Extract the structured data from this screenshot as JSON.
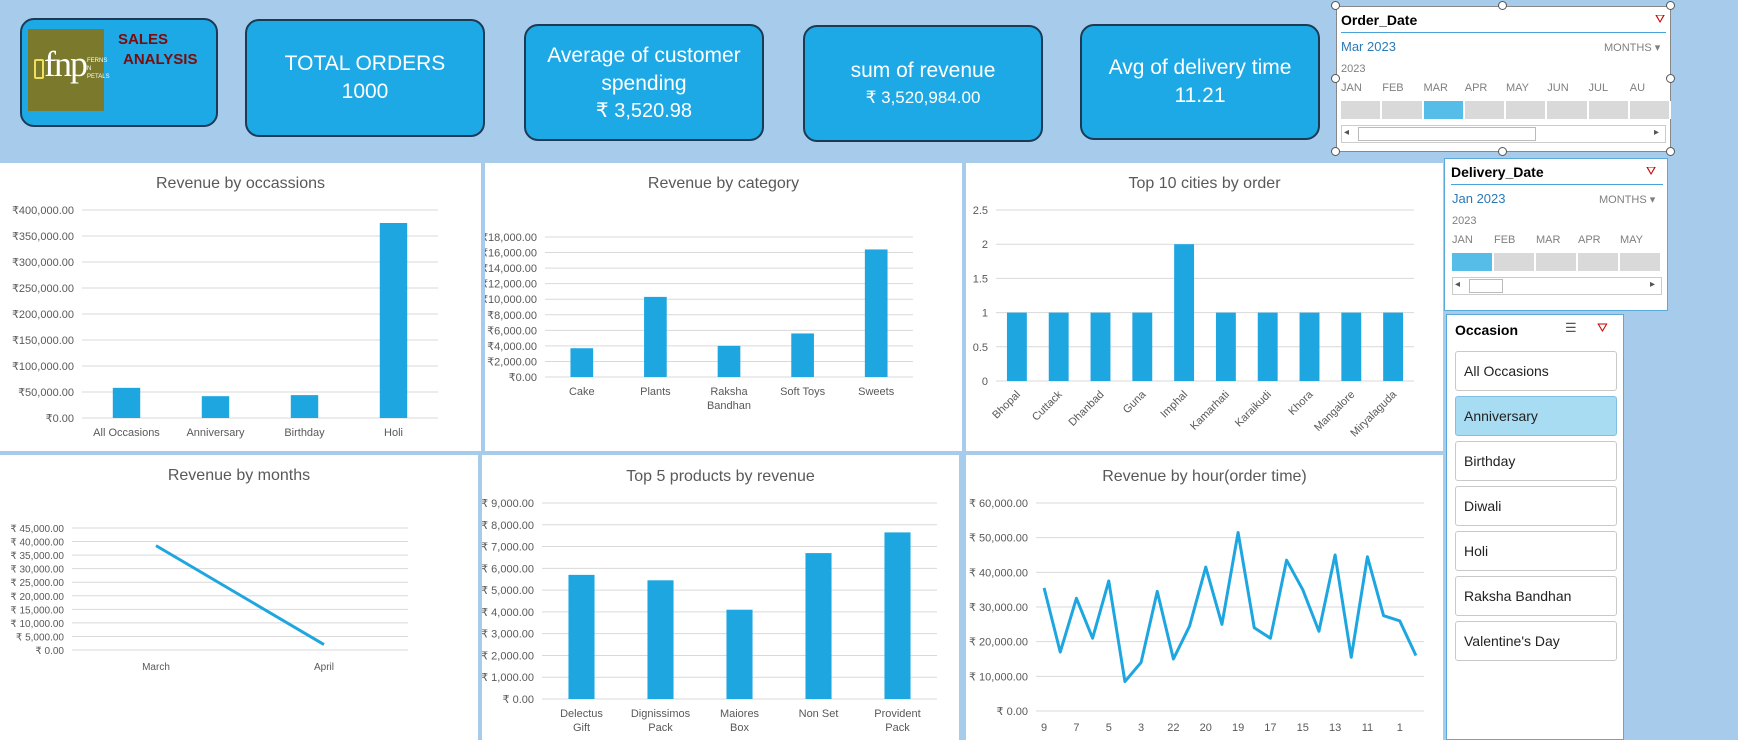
{
  "header": {
    "logo_text": "fnp",
    "logo_sub": "FERNS N PETALS",
    "title_line1": "SALES",
    "title_line2": "ANALYSIS"
  },
  "kpis": {
    "orders": {
      "title": "TOTAL ORDERS",
      "value": "1000"
    },
    "avg_spend": {
      "title1": "Average of customer",
      "title2": "spending",
      "value": "₹ 3,520.98"
    },
    "revenue": {
      "title": "sum of revenue",
      "value": "₹ 3,520,984.00"
    },
    "delivery": {
      "title": "Avg of delivery time",
      "value": "11.21"
    }
  },
  "slicers": {
    "order_date": {
      "title": "Order_Date",
      "selection": "Mar 2023",
      "mode": "MONTHS",
      "year": "2023",
      "months": [
        "JAN",
        "FEB",
        "MAR",
        "APR",
        "MAY",
        "JUN",
        "JUL",
        "AU"
      ],
      "selected_index": 2
    },
    "delivery_date": {
      "title": "Delivery_Date",
      "selection": "Jan 2023",
      "mode": "MONTHS",
      "year": "2023",
      "months": [
        "JAN",
        "FEB",
        "MAR",
        "APR",
        "MAY"
      ],
      "selected_index": 0
    },
    "occasion": {
      "title": "Occasion",
      "items": [
        "All Occasions",
        "Anniversary",
        "Birthday",
        "Diwali",
        "Holi",
        "Raksha Bandhan",
        "Valentine's Day"
      ],
      "selected": "Anniversary"
    }
  },
  "chart_data": [
    {
      "id": "occasions",
      "type": "bar",
      "title": "Revenue by occassions",
      "categories": [
        "All Occasions",
        "Anniversary",
        "Birthday",
        "Holi"
      ],
      "values": [
        58000,
        42000,
        44000,
        375000
      ],
      "ylim": [
        0,
        400000
      ],
      "ticks": [
        "₹0.00",
        "₹50,000.00",
        "₹100,000.00",
        "₹150,000.00",
        "₹200,000.00",
        "₹250,000.00",
        "₹300,000.00",
        "₹350,000.00",
        "₹400,000.00"
      ]
    },
    {
      "id": "category",
      "type": "bar",
      "title": "Revenue by category",
      "categories": [
        "Cake",
        "Plants",
        "Raksha Bandhan",
        "Soft Toys",
        "Sweets"
      ],
      "values": [
        3700,
        10300,
        4000,
        5600,
        16400
      ],
      "ylim": [
        0,
        18000
      ],
      "ticks": [
        "₹0.00",
        "₹2,000.00",
        "₹4,000.00",
        "₹6,000.00",
        "₹8,000.00",
        "₹10,000.00",
        "₹12,000.00",
        "₹14,000.00",
        "₹16,000.00",
        "₹18,000.00"
      ]
    },
    {
      "id": "cities",
      "type": "bar",
      "title": "Top 10 cities by order",
      "categories": [
        "Bhopal",
        "Cuttack",
        "Dhanbad",
        "Guna",
        "Imphal",
        "Kamarhati",
        "Karaikudi",
        "Khora",
        "Mangalore",
        "Miryalaguda"
      ],
      "values": [
        1,
        1,
        1,
        1,
        2,
        1,
        1,
        1,
        1,
        1
      ],
      "ylim": [
        0,
        2.5
      ],
      "ticks": [
        "0",
        "0.5",
        "1",
        "1.5",
        "2",
        "2.5"
      ]
    },
    {
      "id": "months",
      "type": "line",
      "title": "Revenue by months",
      "categories": [
        "March",
        "April"
      ],
      "values": [
        38500,
        2000
      ],
      "ylim": [
        0,
        45000
      ],
      "ticks": [
        "₹ 0.00",
        "₹ 5,000.00",
        "₹ 10,000.00",
        "₹ 15,000.00",
        "₹ 20,000.00",
        "₹ 25,000.00",
        "₹ 30,000.00",
        "₹ 35,000.00",
        "₹ 40,000.00",
        "₹ 45,000.00"
      ]
    },
    {
      "id": "products",
      "type": "bar",
      "title": "Top 5 products by revenue",
      "categories": [
        "Delectus Gift",
        "Dignissimos Pack",
        "Maiores Box",
        "Non Set",
        "Provident Pack"
      ],
      "values": [
        5700,
        5450,
        4100,
        6700,
        7650
      ],
      "ylim": [
        0,
        9000
      ],
      "ticks": [
        "₹ 0.00",
        "₹ 1,000.00",
        "₹ 2,000.00",
        "₹ 3,000.00",
        "₹ 4,000.00",
        "₹ 5,000.00",
        "₹ 6,000.00",
        "₹ 7,000.00",
        "₹ 8,000.00",
        "₹ 9,000.00"
      ]
    },
    {
      "id": "hours",
      "type": "line",
      "title": "Revenue by hour(order time)",
      "categories": [
        "9",
        "",
        "7",
        "",
        "5",
        "",
        "3",
        "",
        "22",
        "",
        "20",
        "",
        "19",
        "",
        "17",
        "",
        "15",
        "",
        "13",
        "",
        "11",
        "",
        "1",
        ""
      ],
      "values": [
        35500,
        17000,
        32500,
        21000,
        37500,
        8500,
        14000,
        34500,
        15000,
        24500,
        41500,
        25000,
        51500,
        24000,
        21000,
        43500,
        35000,
        23000,
        45000,
        15500,
        44500,
        27500,
        26000,
        16000
      ],
      "ylim": [
        0,
        60000
      ],
      "ticks": [
        "₹ 0.00",
        "₹ 10,000.00",
        "₹ 20,000.00",
        "₹ 30,000.00",
        "₹ 40,000.00",
        "₹ 50,000.00",
        "₹ 60,000.00"
      ]
    }
  ],
  "colors": {
    "bar": "#1ea6e1",
    "background": "#a7cceb",
    "kpi": "#1ca9e6"
  }
}
